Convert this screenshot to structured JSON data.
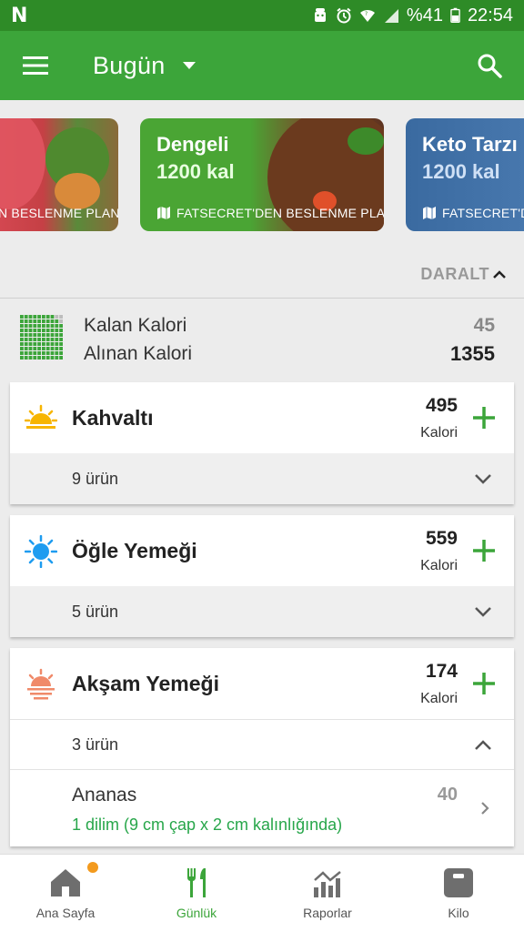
{
  "status_bar": {
    "app_glyph": "N",
    "battery": "%41",
    "time": "22:54",
    "icons": [
      "android-icon",
      "alarm-icon",
      "wifi-icon",
      "signal-icon",
      "battery-icon"
    ]
  },
  "app_bar": {
    "title": "Bugün",
    "menu_icon": "menu-icon",
    "dropdown_icon": "caret-down-icon",
    "search_icon": "search-icon"
  },
  "plans": [
    {
      "name": "",
      "kcal": "",
      "source": "N BESLENME PLANLA"
    },
    {
      "name": "Dengeli",
      "kcal": "1200 kal",
      "source": "FATSECRET'DEN BESLENME PLANLA"
    },
    {
      "name": "Keto Tarzı",
      "kcal": "1200 kal",
      "source": "FATSECRET'DE"
    }
  ],
  "collapse_label": "DARALT",
  "summary": {
    "remaining_label": "Kalan Kalori",
    "consumed_label": "Alınan Kalori",
    "remaining_value": "45",
    "consumed_value": "1355"
  },
  "meals": [
    {
      "name": "Kahvaltı",
      "kcal": "495",
      "kcal_label": "Kalori",
      "items_text": "9 ürün",
      "icon": "sunrise-icon"
    },
    {
      "name": "Öğle Yemeği",
      "kcal": "559",
      "kcal_label": "Kalori",
      "items_text": "5 ürün",
      "icon": "sun-icon"
    },
    {
      "name": "Akşam Yemeği",
      "kcal": "174",
      "kcal_label": "Kalori",
      "items_text": "3 ürün",
      "icon": "sunset-icon"
    }
  ],
  "dinner_items": [
    {
      "name": "Ananas",
      "kcal": "40",
      "portion": "1  dilim (9 cm çap x 2 cm kalınlığında)"
    }
  ],
  "bottom_nav": [
    {
      "label": "Ana Sayfa",
      "icon": "home-icon"
    },
    {
      "label": "Günlük",
      "icon": "fork-knife-icon"
    },
    {
      "label": "Raporlar",
      "icon": "chart-icon"
    },
    {
      "label": "Kilo",
      "icon": "scale-icon"
    }
  ],
  "colors": {
    "status_bar": "#2e8b27",
    "app_bar": "#3ca53a",
    "accent_green": "#3ca53a",
    "portion_green": "#27a64a",
    "notification": "#f39a1e"
  }
}
